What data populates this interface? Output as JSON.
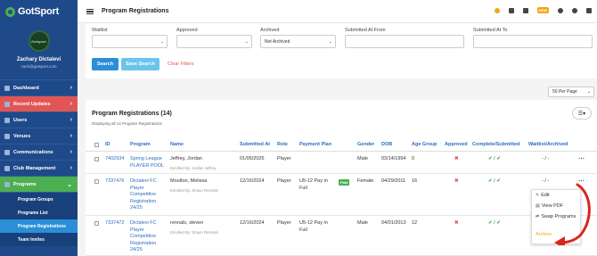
{
  "brand": {
    "name": "GotSport",
    "logo_color": "#4caf50"
  },
  "user": {
    "name": "Zachary Dictalevi",
    "email": "zach@gotsport.com",
    "avatar_text": "Gotsport"
  },
  "sidebar": {
    "items": [
      {
        "label": "Dashboard",
        "icon": "dashboard-icon"
      },
      {
        "label": "Recent Updates",
        "icon": "bell-icon"
      },
      {
        "label": "Users",
        "icon": "users-icon"
      },
      {
        "label": "Venues",
        "icon": "map-icon"
      },
      {
        "label": "Communications",
        "icon": "mail-icon"
      },
      {
        "label": "Club Management",
        "icon": "club-icon"
      },
      {
        "label": "Programs",
        "icon": "programs-icon"
      }
    ],
    "sub_items": [
      "Program Groups",
      "Programs List",
      "Program Registrations",
      "Team Invites"
    ]
  },
  "topbar": {
    "title": "Program Registrations",
    "new_badge": "NEW"
  },
  "filters": {
    "waitlist": {
      "label": "Waitlist",
      "value": ""
    },
    "approved": {
      "label": "Approved",
      "value": ""
    },
    "archived": {
      "label": "Archived",
      "value": "Not Archived"
    },
    "submitted_from": {
      "label": "Submitted At From",
      "value": ""
    },
    "submitted_to": {
      "label": "Submitted At To",
      "value": ""
    },
    "search_label": "Search",
    "save_search_label": "Save Search",
    "clear_label": "Clear Filters"
  },
  "per_page": "50 Per Page",
  "table": {
    "title": "Program Registrations (14)",
    "subtitle": "Displaying all 14 Program Registrations",
    "columns": [
      "ID",
      "Program",
      "Name",
      "Submitted At",
      "Role",
      "Payment Plan",
      "Gender",
      "DOB",
      "Age Group",
      "Approved",
      "Complete/Submitted",
      "Waitlist/Archived"
    ],
    "rows": [
      {
        "id": "7402934",
        "program": "Spring League PLAYER POOL",
        "name": "Jeffrey, Jordan",
        "enrolled": "Enrolled By: Jordan Jeffrey",
        "submitted": "01/05/2025",
        "role": "Player",
        "payment": "",
        "paid": "",
        "gender": "Male",
        "dob": "03/14/1994",
        "age": "0",
        "approved": "✖",
        "complete": "✔ / ✔",
        "waitlist": "- / -"
      },
      {
        "id": "7337476",
        "program": "Dictalevi FC Player Competitive Registration 24/25",
        "name": "Moulton, Melissa",
        "enrolled": "Enrolled By: Shaun Rennals",
        "submitted": "12/16/2024",
        "role": "Player",
        "payment": "U5-12 Pay in Full",
        "paid": "Paid",
        "gender": "Female",
        "dob": "04/29/2011",
        "age": "16",
        "approved": "✖",
        "complete": "✔ / ✔",
        "waitlist": "- / -"
      },
      {
        "id": "7337472",
        "program": "Dictalevi FC Player Competitive Registration 24/25",
        "name": "rennals, steven",
        "enrolled": "Enrolled By: Shaun Rennals",
        "submitted": "12/16/2024",
        "role": "Player",
        "payment": "U5-12 Pay in Full",
        "paid": "",
        "gender": "Male",
        "dob": "04/01/2013",
        "age": "12",
        "approved": "✖",
        "complete": "✔ / ✔",
        "waitlist": "- / -"
      }
    ]
  },
  "row_menu": {
    "items": [
      "Edit",
      "View PDF",
      "Swap Programs"
    ],
    "archive": "Archive"
  },
  "colors": {
    "sidebar": "#1f4a8a",
    "accent_blue": "#2a8fd6",
    "recent_updates": "#e25555",
    "active_green": "#4caf50",
    "archive_orange": "#f0a818",
    "arrow_red": "#d9271f"
  }
}
